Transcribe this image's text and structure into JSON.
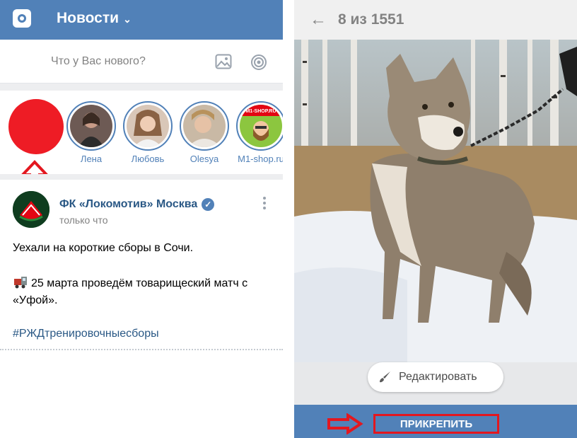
{
  "left": {
    "header": {
      "title": "Новости",
      "chevron_icon": "chevron-down-icon"
    },
    "compose": {
      "placeholder": "Что у Вас нового?"
    },
    "stories": [
      {
        "name": "Лена"
      },
      {
        "name": "Любовь"
      },
      {
        "name": "Olesya"
      },
      {
        "name": "M1-shop.ru"
      }
    ],
    "story_badge_text": "M1-SHOP.RU",
    "post": {
      "author": "ФК «Локомотив» Москва",
      "time": "только что",
      "line1": "Уехали на короткие сборы в Сочи.",
      "line2": "25 марта проведём товарищеский матч с",
      "line3": "«Уфой».",
      "hashtag": "#РЖДтренировочныесборы"
    }
  },
  "right": {
    "counter": "8 из 1551",
    "edit_label": "Редактировать",
    "attach_label": "ПРИКРЕПИТЬ"
  },
  "colors": {
    "accent": "#5181b8",
    "highlight_red": "#e3171f",
    "link": "#2a5885"
  }
}
